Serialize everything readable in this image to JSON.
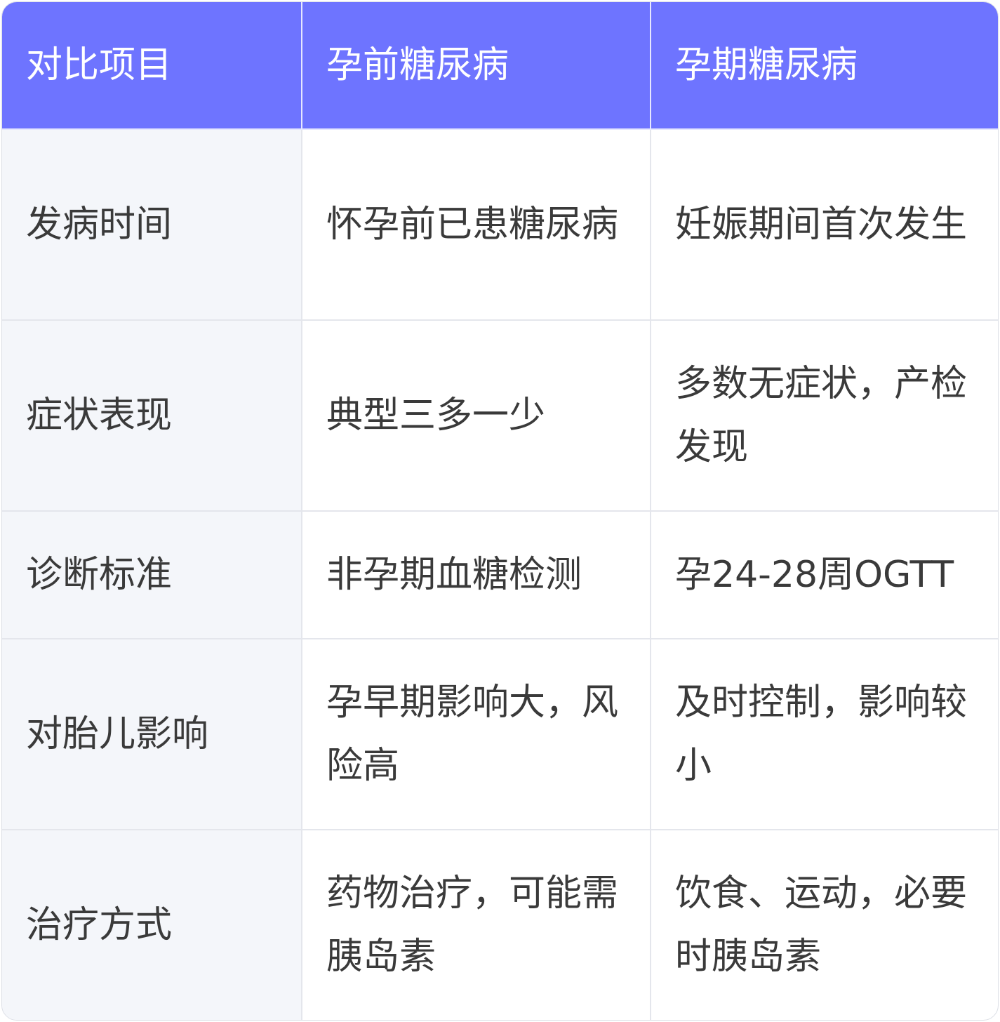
{
  "table": {
    "headers": [
      "对比项目",
      "孕前糖尿病",
      "孕期糖尿病"
    ],
    "rows": [
      [
        "发病时间",
        "怀孕前已患糖尿病",
        "妊娠期间首次发生"
      ],
      [
        "症状表现",
        "典型三多一少",
        "多数无症状，产检发现"
      ],
      [
        "诊断标准",
        "非孕期血糖检测",
        "孕24-28周OGTT"
      ],
      [
        "对胎儿影响",
        "孕早期影响大，风险高",
        "及时控制，影响较小"
      ],
      [
        "治疗方式",
        "药物治疗，可能需胰岛素",
        "饮食、运动，必要时胰岛素"
      ]
    ]
  },
  "colors": {
    "header_bg": "#6e74ff",
    "header_text": "#ffffff",
    "first_col_bg": "#f4f6fa",
    "border": "#e4e6ec",
    "text": "#3a3a3a"
  }
}
